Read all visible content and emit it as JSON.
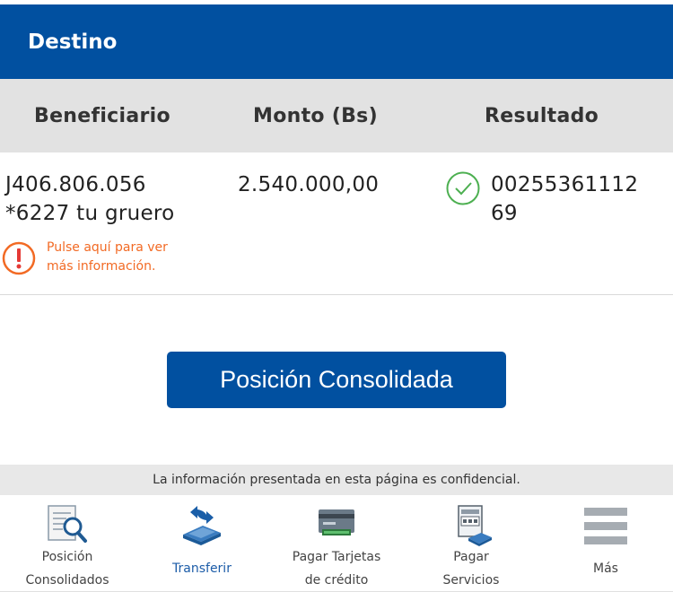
{
  "header": {
    "title": "Destino"
  },
  "columns": {
    "beneficiario": "Beneficiario",
    "monto": "Monto (Bs)",
    "resultado": "Resultado"
  },
  "row": {
    "beneficiario_line1": "J406.806.056",
    "beneficiario_line2": "*6227 tu gruero",
    "warning_line1": "Pulse aquí para ver",
    "warning_line2": "más información.",
    "monto": "2.540.000,00",
    "resultado_line1": "00255361112",
    "resultado_line2": "69"
  },
  "button": {
    "label": "Posición Consolidada"
  },
  "notice": "La información presentada en esta página es confidencial.",
  "nav": [
    {
      "line1": "Posición",
      "line2": "Consolidados",
      "icon": "search-document-icon"
    },
    {
      "line1": "Transferir",
      "line2": "",
      "icon": "transfer-icon",
      "active": true
    },
    {
      "line1": "Pagar Tarjetas",
      "line2": "de crédito",
      "icon": "credit-card-icon"
    },
    {
      "line1": "Pagar",
      "line2": "Servicios",
      "icon": "bill-payment-icon"
    },
    {
      "line1": "Más",
      "line2": "",
      "icon": "menu-icon"
    }
  ],
  "colors": {
    "brand_blue": "#0150a0",
    "warning_orange": "#f26a24",
    "success_green": "#4caf50"
  }
}
